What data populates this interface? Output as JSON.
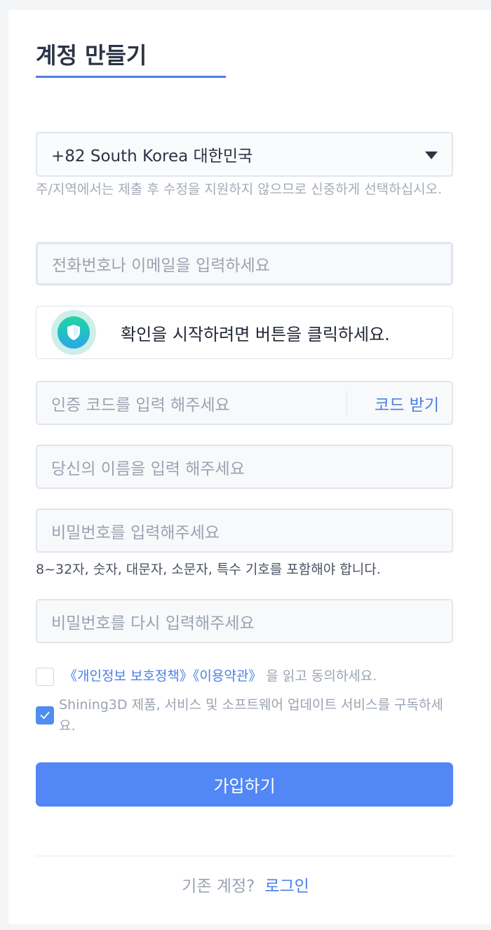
{
  "page": {
    "title": "계정 만들기"
  },
  "region": {
    "selected": "+82 South Korea 대한민국",
    "hint": "주/지역에서는 제출 후 수정을 지원하지 않으므로 신중하게 선택하십시오."
  },
  "phone": {
    "placeholder": "전화번호나 이메일을 입력하세요"
  },
  "captcha": {
    "text": "확인을 시작하려면 버튼을 클릭하세요."
  },
  "code": {
    "placeholder": "인증 코드를 입력 해주세요",
    "button": "코드 받기"
  },
  "name": {
    "placeholder": "당신의 이름을 입력 해주세요"
  },
  "password": {
    "placeholder": "비밀번호를 입력해주세요",
    "hint": "8~32자, 숫자, 대문자, 소문자, 특수 기호를 포함해야 합니다."
  },
  "password_confirm": {
    "placeholder": "비밀번호를 다시 입력해주세요"
  },
  "agreements": {
    "privacy_link": "《개인정보 보호정책》",
    "terms_link": "《이용약관》",
    "agree_suffix": "을 읽고 동의하세요.",
    "agree_checked": false,
    "subscribe_text": "Shining3D 제품, 서비스 및 소프트웨어 업데이트 서비스를 구독하세요.",
    "subscribe_checked": true
  },
  "submit": {
    "label": "가입하기"
  },
  "footer": {
    "question": "기존 계정?",
    "login_link": "로그인"
  },
  "colors": {
    "accent": "#5287f5",
    "link": "#4a7fe6",
    "title": "#2b3445"
  }
}
